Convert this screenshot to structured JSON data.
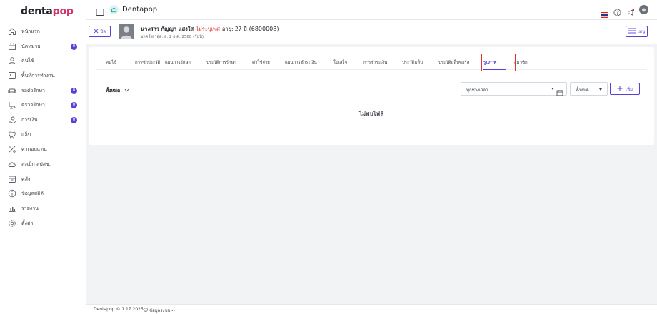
{
  "brand": {
    "logo_main": "denta",
    "logo_accent": "pop",
    "app_name": "Dentapop"
  },
  "sidebar": {
    "items": [
      {
        "label": "หน้าแรก",
        "icon": "home-icon"
      },
      {
        "label": "นัดหมาย",
        "icon": "calendar-icon",
        "badge": "0"
      },
      {
        "label": "คนไข้",
        "icon": "user-icon"
      },
      {
        "label": "พื้นที่การทำงาน",
        "icon": "workspace-icon"
      },
      {
        "label": "รอตัวรักษา",
        "icon": "sofa-icon",
        "badge": "0"
      },
      {
        "label": "ตรวจรักษา",
        "icon": "dental-chair-icon",
        "badge": "0"
      },
      {
        "label": "การเงิน",
        "icon": "money-hand-icon",
        "badge": "0"
      },
      {
        "label": "แล็บ",
        "icon": "tooth-icon"
      },
      {
        "label": "ค่าตอบแทน",
        "icon": "percent-icon"
      },
      {
        "label": "ส่งเบิก สปสช.",
        "icon": "cloud-icon"
      },
      {
        "label": "คลัง",
        "icon": "box-icon"
      },
      {
        "label": "ข้อมูลสถิติ",
        "icon": "info-circle-icon"
      },
      {
        "label": "รายงาน",
        "icon": "bar-chart-icon"
      },
      {
        "label": "ตั้งค่า",
        "icon": "gear-icon"
      }
    ]
  },
  "patient": {
    "close_label": "ปิด",
    "name": "นางสาว กัญญา แสงใส",
    "gender": "ไม่ระบุเพศ",
    "age": "อายุ: 27 ปี",
    "id": "(6800008)",
    "last_visit": "มาครั้งล่าสุด: อ. 2 ธ.ค. 2568 (วันนี้)",
    "menu_label": "เมนู"
  },
  "tabs": [
    {
      "label": "คนไข้"
    },
    {
      "label": "การซักประวัติ"
    },
    {
      "label": "แผนการรักษา"
    },
    {
      "label": "ประวัติการรักษา"
    },
    {
      "label": "ค่าใช้จ่าย"
    },
    {
      "label": "แผนการชำระเงิน"
    },
    {
      "label": "ใบเสร็จ"
    },
    {
      "label": "การชำระเงิน"
    },
    {
      "label": "ประวัติแล็บ"
    },
    {
      "label": "ประวัติแล็บซอร์ส"
    },
    {
      "label": "รูปภาพ",
      "active": true
    },
    {
      "label": "สมาชิก"
    }
  ],
  "filters": {
    "category": "ทั้งหมด",
    "date_range": "ทุกช่วงเวลา",
    "type": "ทั้งหมด",
    "add_label": "เพิ่ม"
  },
  "empty_message": "ไม่พบไฟล์",
  "footer": {
    "copyright": "Dentapop © 1.17 2025",
    "info_label": "ข้อมูลระบบ"
  },
  "colors": {
    "accent": "#5b3fd9",
    "danger": "#e03131",
    "logo_pop": "#d6336c"
  }
}
